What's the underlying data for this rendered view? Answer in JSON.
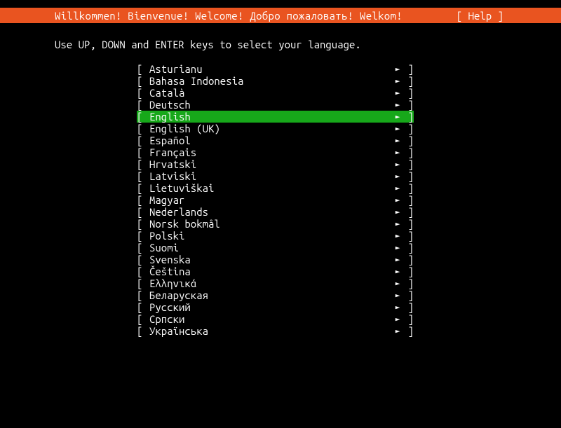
{
  "header": {
    "title": "Willkommen! Bienvenue! Welcome! Добро пожаловать! Welkom!",
    "help": "[ Help ]"
  },
  "instruction": "Use UP, DOWN and ENTER keys to select your language.",
  "selected_index": 4,
  "languages": [
    "Asturianu",
    "Bahasa Indonesia",
    "Català",
    "Deutsch",
    "English",
    "English (UK)",
    "Español",
    "Français",
    "Hrvatski",
    "Latviski",
    "Lietuviškai",
    "Magyar",
    "Nederlands",
    "Norsk bokmål",
    "Polski",
    "Suomi",
    "Svenska",
    "Čeština",
    "Ελληνικά",
    "Беларуская",
    "Русский",
    "Српски",
    "Українська"
  ],
  "brackets": {
    "open": "[",
    "close": "]"
  },
  "arrow": "►"
}
